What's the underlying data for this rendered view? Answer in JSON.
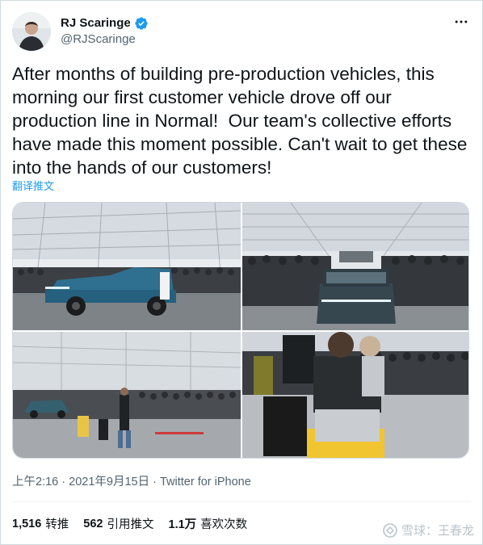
{
  "user": {
    "display_name": "RJ Scaringe",
    "handle": "@RJScaringe",
    "verified": true
  },
  "tweet": {
    "text": "After months of building pre-production vehicles, this morning our first customer vehicle drove off our production line in Normal!  Our team's collective efforts have made this moment possible. Can't wait to get these into the hands of our customers!",
    "translate_label": "翻译推文"
  },
  "meta": {
    "time": "上午2:16",
    "sep1": " · ",
    "date": "2021年9月15日",
    "sep2": " · ",
    "source": "Twitter for iPhone"
  },
  "stats": {
    "retweets_count": "1,516",
    "retweets_label": "转推",
    "quotes_count": "562",
    "quotes_label": "引用推文",
    "likes_count": "1.1万",
    "likes_label": "喜欢次数"
  },
  "watermark": {
    "text": "雪球：王春龙"
  },
  "colors": {
    "accent": "#1d9bf0",
    "text_primary": "#0f1419",
    "text_secondary": "#536471",
    "border": "#cfd9de"
  },
  "icons": {
    "verified": "verified-badge-icon",
    "more": "more-options-icon"
  }
}
